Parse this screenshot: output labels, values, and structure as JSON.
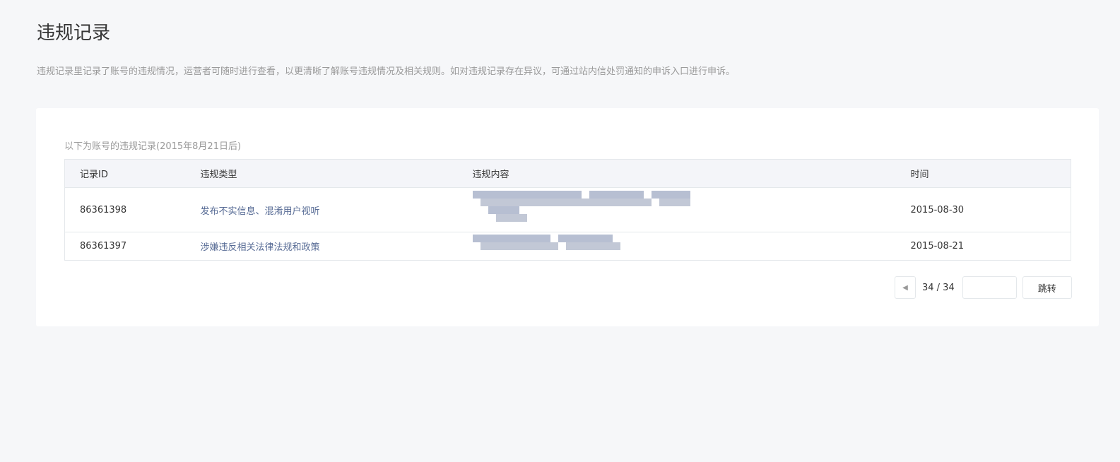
{
  "page": {
    "title": "违规记录",
    "description": "违规记录里记录了账号的违规情况，运营者可随时进行查看，以更清晰了解账号违规情况及相关规则。如对违规记录存在异议，可通过站内信处罚通知的申诉入口进行申诉。"
  },
  "card": {
    "subtitle": "以下为账号的违规记录(2015年8月21日后)"
  },
  "table": {
    "headers": [
      "记录ID",
      "违规类型",
      "违规内容",
      "时间"
    ],
    "rows": [
      {
        "id": "86361398",
        "type": "发布不实信息、混淆用户视听",
        "date": "2015-08-30"
      },
      {
        "id": "86361397",
        "type": "涉嫌违反相关法律法规和政策",
        "date": "2015-08-21"
      }
    ]
  },
  "pagination": {
    "current": "34 / 34",
    "jump_label": "跳转",
    "input_value": ""
  }
}
